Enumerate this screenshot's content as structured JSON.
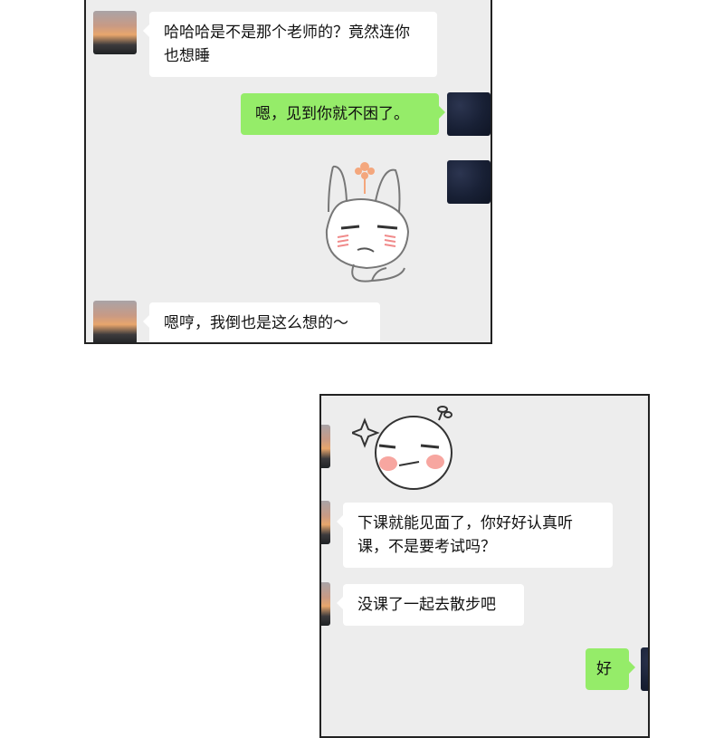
{
  "panel1": {
    "messages": [
      {
        "side": "left",
        "text": "哈哈哈是不是那个老师的？竟然连你也想睡"
      },
      {
        "side": "right",
        "text": "嗯，见到你就不困了。"
      },
      {
        "side": "right",
        "sticker": "sleepy-rabbit-sticker"
      },
      {
        "side": "left",
        "text": "嗯哼，我倒也是这么想的～"
      }
    ]
  },
  "panel2": {
    "messages": [
      {
        "side": "left",
        "sticker": "smug-face-sticker"
      },
      {
        "side": "left",
        "text": "下课就能见面了，你好好认真听课，不是要考试吗？"
      },
      {
        "side": "left",
        "text": "没课了一起去散步吧"
      },
      {
        "side": "right",
        "text": "好"
      }
    ]
  },
  "colors": {
    "chat_background": "#ededed",
    "sent_bubble": "#95ec69",
    "received_bubble": "#ffffff",
    "panel_border": "#222222"
  }
}
